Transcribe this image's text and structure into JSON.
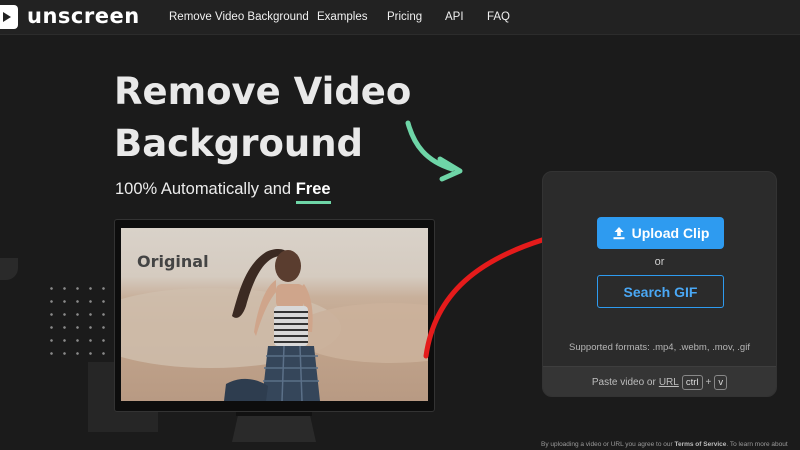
{
  "brand": {
    "name": "unscreen"
  },
  "nav": {
    "items": [
      {
        "label": "Remove Video Background"
      },
      {
        "label": "Examples"
      },
      {
        "label": "Pricing"
      },
      {
        "label": "API"
      },
      {
        "label": "FAQ"
      }
    ]
  },
  "hero": {
    "title_line1": "Remove Video",
    "title_line2": "Background",
    "subtitle_prefix": "100% Automatically and ",
    "subtitle_emphasis": "Free",
    "preview_label": "Original"
  },
  "upload_card": {
    "upload_button": "Upload Clip",
    "or_text": "or",
    "search_button": "Search GIF",
    "supported_formats": "Supported formats: .mp4, .webm, .mov, .gif",
    "paste_prefix": "Paste video or",
    "paste_url": "URL",
    "key_ctrl": "ctrl",
    "key_plus": "+",
    "key_v": "v"
  },
  "footer": {
    "terms_prefix": "By uploading a video or URL you agree to our",
    "terms_link": "Terms of Service",
    "terms_suffix": ". To learn more about"
  },
  "colors": {
    "background": "#1b1b1b",
    "navbar": "#222222",
    "accent_blue": "#2e9bf0",
    "accent_green": "#6ed5a7",
    "annotation_red": "#e51b1b"
  },
  "icons": {
    "logo": "play-icon",
    "upload": "upload-icon",
    "decor_arrow_green": "curved-arrow-icon",
    "annotation_arrow_red": "curved-arrow-icon"
  }
}
